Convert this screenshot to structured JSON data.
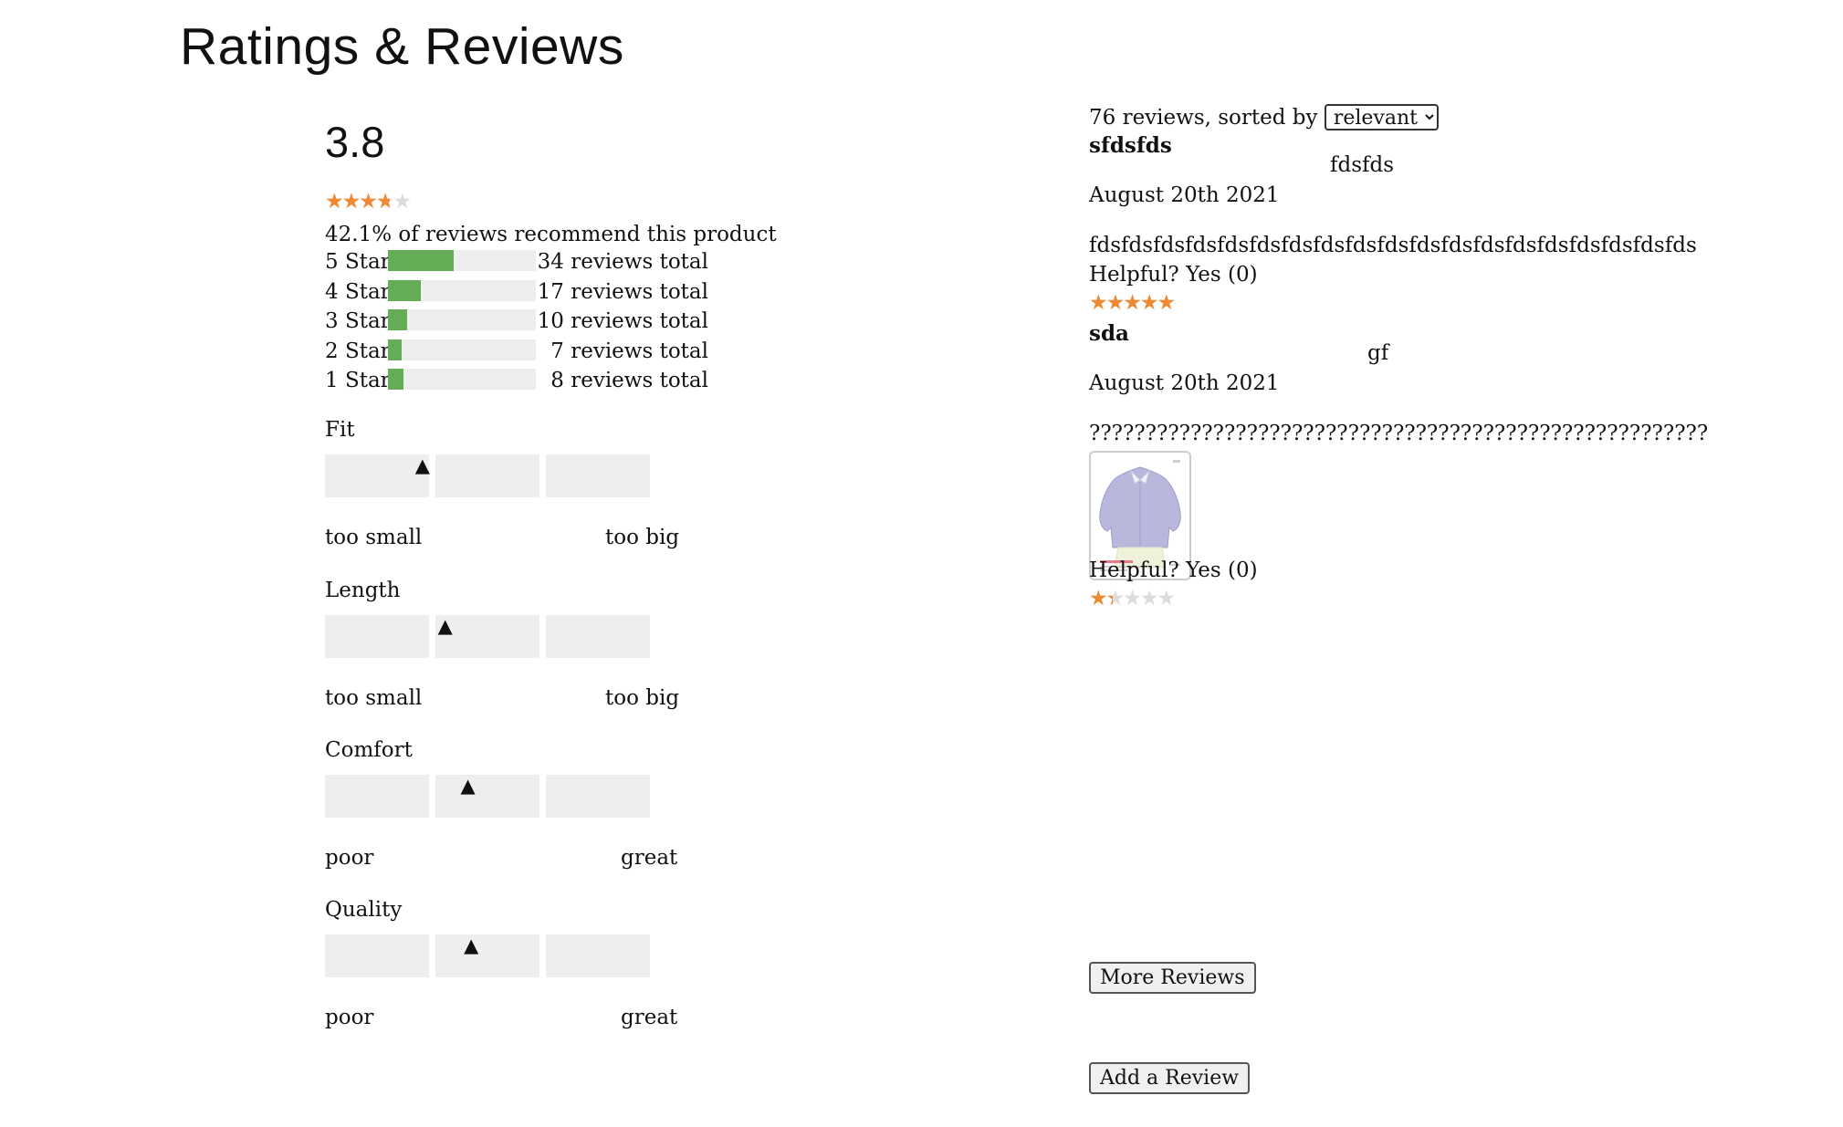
{
  "page": {
    "title": "Ratings & Reviews"
  },
  "summary": {
    "average": "3.8",
    "average_stars": 3.8,
    "recommend_text": "42.1% of reviews recommend this product",
    "breakdown": [
      {
        "label": "5 Stars",
        "count_text": "34 reviews total",
        "fraction": 0.447
      },
      {
        "label": "4 Stars",
        "count_text": "17 reviews total",
        "fraction": 0.224
      },
      {
        "label": "3 Stars",
        "count_text": "10 reviews total",
        "fraction": 0.132
      },
      {
        "label": "2 Stars",
        "count_text": "7 reviews total",
        "fraction": 0.092
      },
      {
        "label": "1 Stars",
        "count_text": "8 reviews total",
        "fraction": 0.105
      }
    ]
  },
  "characteristics": [
    {
      "name": "Fit",
      "low": "too small",
      "high": "too big",
      "marker_position": 0.3
    },
    {
      "name": "Length",
      "low": "too small",
      "high": "too big",
      "marker_position": 0.37
    },
    {
      "name": "Comfort",
      "low": "poor",
      "high": "great",
      "marker_position": 0.44
    },
    {
      "name": "Quality",
      "low": "poor",
      "high": "great",
      "marker_position": 0.45
    }
  ],
  "reviews_list": {
    "sort_prefix": "76 reviews, sorted by",
    "sort_selected": "relevant",
    "reviews": [
      {
        "user": "sfdsfds",
        "summary": "fdsfds",
        "date": "August 20th 2021",
        "body": "fdsfdsfdsfdsfdsfdsfdsfdsfdsfdsfdsfdsfdsfdsfdsfdsfdsfdsfds",
        "helpful": "Helpful? Yes (0)",
        "rating": 5
      },
      {
        "user": "sda",
        "summary": "gf",
        "date": "August 20th 2021",
        "body": "???????????????????????????????????????????????????????",
        "has_photo": true,
        "helpful": "Helpful? Yes (0)",
        "rating": 1.4
      }
    ],
    "more_button": "More Reviews",
    "add_button": "Add a Review"
  },
  "colors": {
    "star": "#ef8a32",
    "star_empty": "#dcdcdc",
    "bar_fill": "#64ac56",
    "bar_track": "#eeeeee"
  },
  "icons": {
    "star": "star-icon",
    "marker": "triangle-up-icon",
    "dropdown": "chevron-down-icon"
  }
}
